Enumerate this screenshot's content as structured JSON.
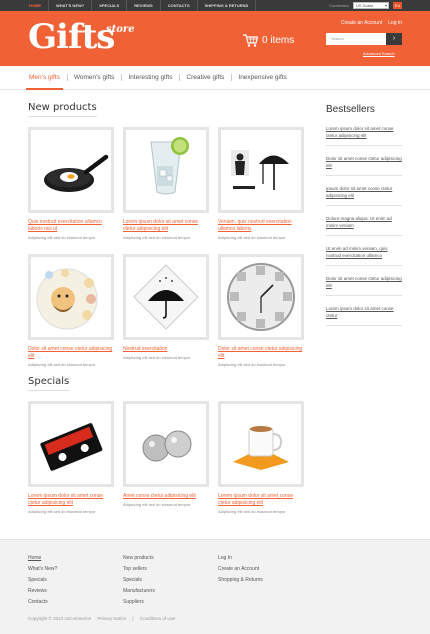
{
  "topnav": {
    "items": [
      "Home",
      "What's new?",
      "Specials",
      "Reviews",
      "Contacts",
      "Shipping & Returns"
    ],
    "currencies_label": "Currencies:",
    "currency_value": "US Dollar",
    "language": "En"
  },
  "header": {
    "logo": "Gifts",
    "logo_sub": "store",
    "cart_text": "0 items",
    "create_account": "Create an Account",
    "login": "Log In",
    "search_placeholder": "Search",
    "advanced_search": "Advanced Search"
  },
  "categories": [
    "Men's gifts",
    "Women's gifts",
    "Interesting gifts",
    "Creative gifts",
    "Inexpensive gifts"
  ],
  "new_products": {
    "title": "New products",
    "items": [
      {
        "title": "Quis nostrud exercitation ullamco laboris nisi ut",
        "desc": "Adipiscing elit sed do eiusmod tempor",
        "image": "frying-pan-egg"
      },
      {
        "title": "Lorem ipsum dolor sit amet conse ctetur adipisicing elit",
        "desc": "Adipiscing elit sed do eiusmod tempor",
        "image": "glass-with-lime"
      },
      {
        "title": "Veniam, quis nostrud exercitation ullamco laboris",
        "desc": "Adipiscing elit sed do eiusmod tempor",
        "image": "umbrella-ninja"
      },
      {
        "title": "Dolor sit amet conse ctetur adipisicing elit",
        "desc": "Adipiscing elit sed do eiusmod tempor",
        "image": "face-magnets"
      },
      {
        "title": "Nostrud exercitation",
        "desc": "Adipiscing elit sed do eiusmod tempor",
        "image": "umbrella-print"
      },
      {
        "title": "Dolor sit amet conse ctetur adipisicing elit",
        "desc": "Adipiscing elit sed do eiusmod tempor",
        "image": "photo-clock"
      }
    ]
  },
  "specials": {
    "title": "Specials",
    "items": [
      {
        "title": "Lorem ipsum dolor sit amet conse ctetur adipisicing elit",
        "desc": "Adipiscing elit sed do eiusmod tempor",
        "image": "cassette"
      },
      {
        "title": "Amet conse ctetur adipisicing elit",
        "desc": "Adipiscing elit sed do eiusmod tempor",
        "image": "silver-balls"
      },
      {
        "title": "Lorem ipsum dolor sit amet conse ctetur adipisicing elit",
        "desc": "Adipiscing elit sed do eiusmod tempor",
        "image": "cup-holder"
      }
    ]
  },
  "bestsellers": {
    "title": "Bestsellers",
    "items": [
      "Lorem ipsum dolor sit amet conse ctetur adipisicing elit",
      "Dolor sit amet conse ctetur adipisicing elit",
      "Ipsum dolor sit amet conse ctetur adipisicing elit",
      "Dolore magna aliqua. Ut enim ad minim veniam",
      "Ut enim ad minim veniam, quis nostrud exercitation ullamco",
      "Dolor sit amet conse ctetur adipisicing elit",
      "Lorem ipsum dolor sit amet conse ctetur"
    ]
  },
  "footer": {
    "col1": [
      "Home",
      "What's New?",
      "Specials",
      "Reviews",
      "Contacts"
    ],
    "col2": [
      "New products",
      "Top sellers",
      "Specials",
      "Manufacturers",
      "Suppliers"
    ],
    "col3": [
      "Log In",
      "Create an Account",
      "Shopping & Returns"
    ],
    "copyright": "Copyright © 2013 osCommerce",
    "privacy": "Privacy Notice",
    "separator": "|",
    "conditions": "Conditions of Use"
  },
  "colors": {
    "accent": "#f06236",
    "dark": "#3a3a3a"
  }
}
